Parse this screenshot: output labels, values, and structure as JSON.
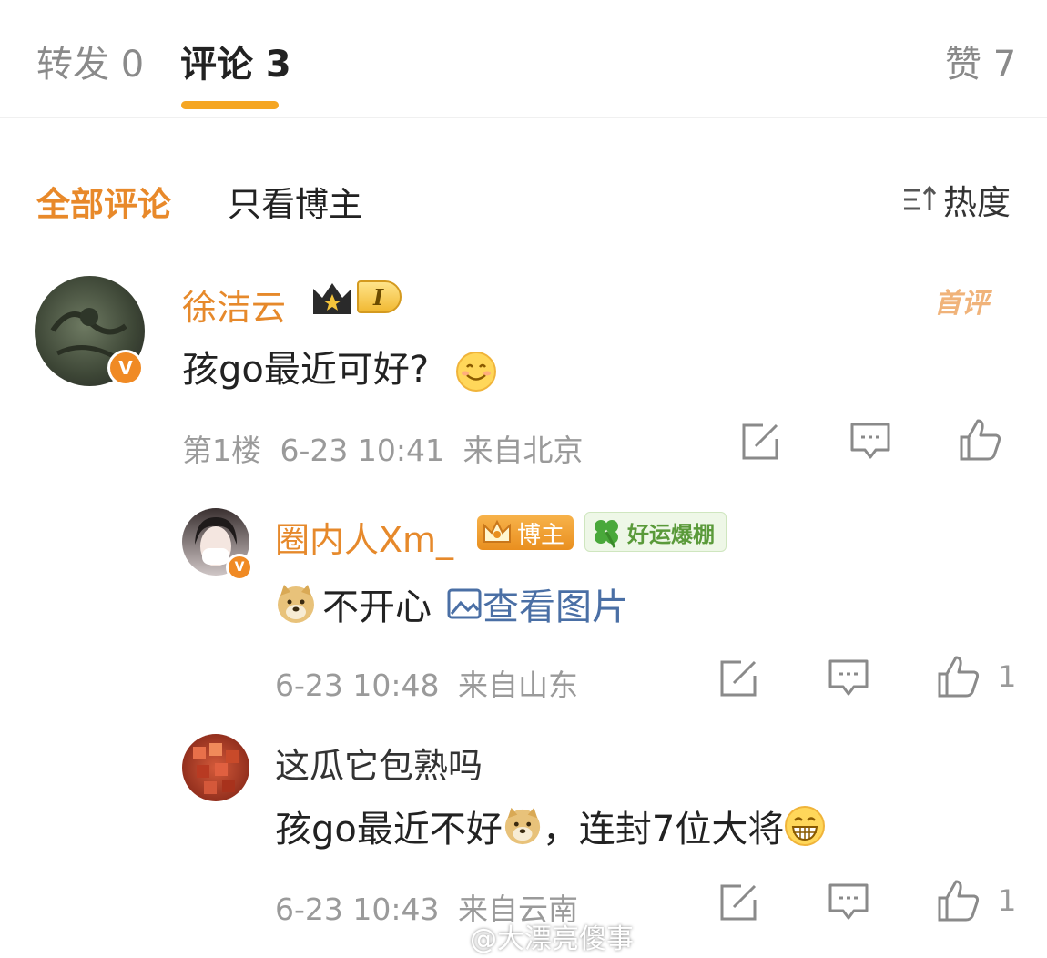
{
  "tabs": {
    "repost": "转发 0",
    "comments": "评论 3",
    "likes": "赞 7"
  },
  "filters": {
    "all": "全部评论",
    "author_only": "只看博主",
    "sort": "热度",
    "sort_icon": "sort-icon"
  },
  "comments": [
    {
      "user": "徐洁云",
      "badge": "I",
      "tag": "首评",
      "text": "孩go最近可好?",
      "emoji": "smile",
      "floor": "第1楼",
      "time": "6-23 10:41",
      "location": "来自北京"
    }
  ],
  "replies": [
    {
      "user": "圈内人Xm_",
      "author_badge": "博主",
      "luck_badge": "好运爆棚",
      "text": "不开心",
      "image_link": "查看图片",
      "time": "6-23 10:48",
      "location": "来自山东",
      "likes": "1"
    },
    {
      "user": "这瓜它包熟吗",
      "text_a": "孩go最近不好",
      "text_b": "，连封7位大将",
      "time": "6-23 10:43",
      "location": "来自云南",
      "likes": "1"
    }
  ],
  "watermark": "@大漂亮傻事"
}
